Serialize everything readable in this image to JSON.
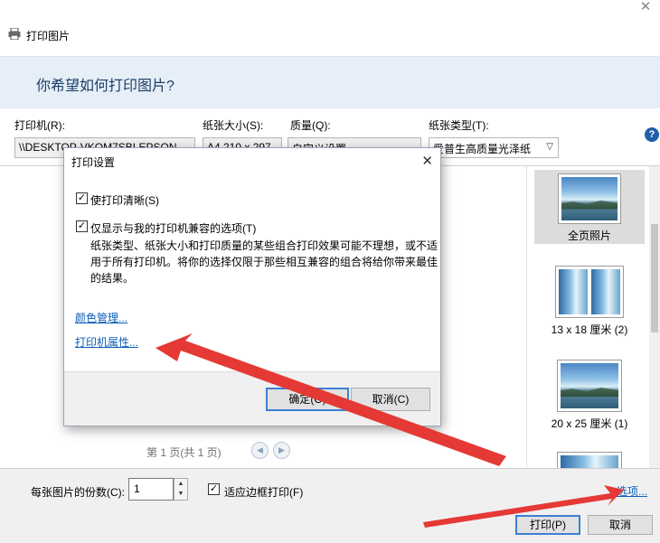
{
  "window": {
    "title": "打印图片",
    "heading": "你希望如何打印图片?"
  },
  "fields": {
    "printer_label": "打印机(R):",
    "printer_value": "\\\\DESKTOP-VKOM7SBLEPSON",
    "paper_size_label": "纸张大小(S):",
    "paper_size_value": "A4 210 x 297",
    "quality_label": "质量(Q):",
    "quality_value": "自定义设置",
    "paper_type_label": "纸张类型(T):",
    "paper_type_value": "爱普生高质量光泽纸"
  },
  "preview": {
    "pager_text": "第 1 页(共 1 页)"
  },
  "layouts": [
    {
      "label": "全页照片",
      "selected": true
    },
    {
      "label": "13 x 18 厘米 (2)",
      "selected": false
    },
    {
      "label": "20 x 25 厘米 (1)",
      "selected": false
    }
  ],
  "bottom": {
    "copies_label": "每张图片的份数(C):",
    "copies_value": "1",
    "fit_label": "适应边框打印(F)",
    "options_link": "选项...",
    "print_button": "打印(P)",
    "cancel_button": "取消"
  },
  "dialog": {
    "title": "打印设置",
    "sharpen_label": "使打印清晰(S)",
    "compat_label": "仅显示与我的打印机兼容的选项(T)",
    "description": "纸张类型、纸张大小和打印质量的某些组合打印效果可能不理想，或不适用于所有打印机。将你的选择仅限于那些相互兼容的组合将给你带来最佳的结果。",
    "color_mgmt_link": "颜色管理...",
    "printer_props_link": "打印机属性...",
    "ok_button": "确定(O)",
    "cancel_button": "取消(C)"
  },
  "colors": {
    "banner_bg": "#e6eef7",
    "link": "#0f5fb8",
    "annotation_arrow": "#e53935"
  },
  "icons": {
    "app": "printer-icon",
    "help": "help-icon",
    "close": "close-icon"
  }
}
